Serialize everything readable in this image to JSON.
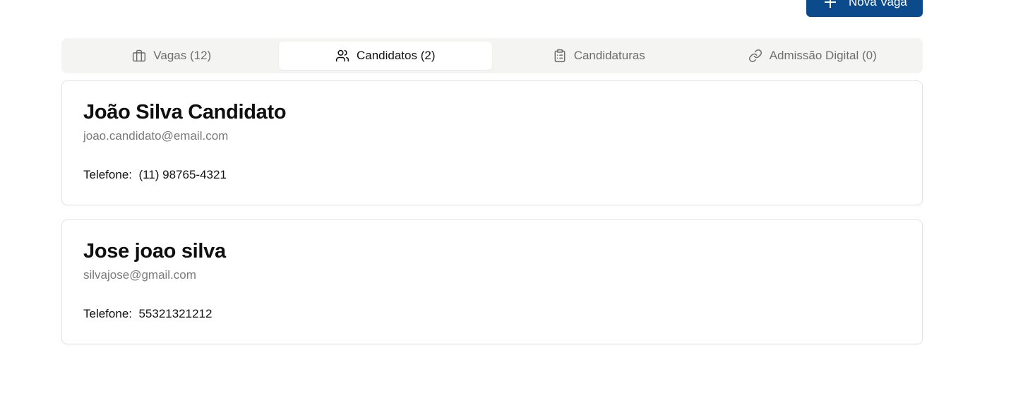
{
  "header": {
    "new_job_button_label": "Nova Vaga"
  },
  "tabs": [
    {
      "label": "Vagas (12)",
      "icon": "briefcase-icon",
      "active": false
    },
    {
      "label": "Candidatos (2)",
      "icon": "users-icon",
      "active": true
    },
    {
      "label": "Candidaturas",
      "icon": "clipboard-icon",
      "active": false
    },
    {
      "label": "Admissão Digital (0)",
      "icon": "link-icon",
      "active": false
    }
  ],
  "candidates": [
    {
      "name": "João Silva Candidato",
      "email": "joao.candidato@email.com",
      "phone_label": "Telefone:",
      "phone": "(11) 98765-4321"
    },
    {
      "name": "Jose joao silva",
      "email": "silvajose@gmail.com",
      "phone_label": "Telefone:",
      "phone": "55321321212"
    }
  ],
  "colors": {
    "primary": "#0b4a8b",
    "tabs_background": "#f4f4f3",
    "muted_text": "#7a7a7a"
  }
}
